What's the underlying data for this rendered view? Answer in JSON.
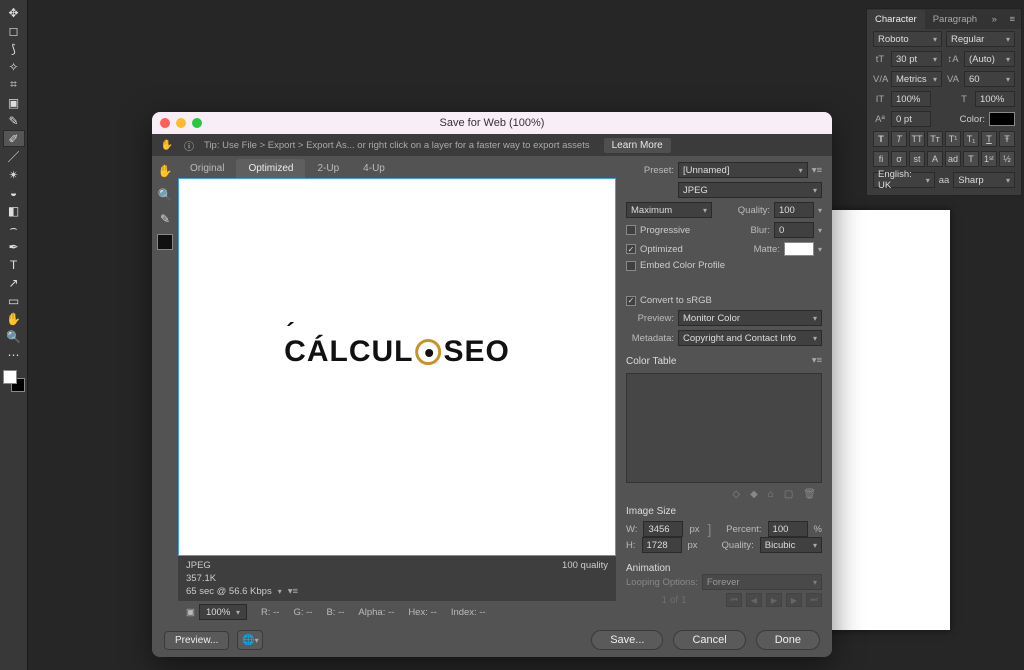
{
  "dialog": {
    "title": "Save for Web (100%)",
    "tip": "Tip: Use File > Export > Export As... or right click on a layer for a faster way to export assets",
    "learn_more": "Learn More",
    "tabs": {
      "original": "Original",
      "optimized": "Optimized",
      "two_up": "2-Up",
      "four_up": "4-Up"
    },
    "preview": {
      "brand_left": "CÁLCUL",
      "brand_right": "SEO",
      "format": "JPEG",
      "size": "357.1K",
      "transfer": "65 sec @ 56.6 Kbps",
      "quality_readout": "100 quality"
    },
    "info": {
      "zoom": "100%",
      "r": "R:  --",
      "g": "G:  --",
      "b": "B:  --",
      "alpha": "Alpha:  --",
      "hex": "Hex:  --",
      "index": "Index:  --"
    },
    "buttons": {
      "preview": "Preview...",
      "save": "Save...",
      "cancel": "Cancel",
      "done": "Done"
    }
  },
  "export": {
    "preset_label": "Preset:",
    "preset_value": "[Unnamed]",
    "format": "JPEG",
    "quality_preset": "Maximum",
    "quality_label": "Quality:",
    "quality_value": "100",
    "progressive": "Progressive",
    "blur_label": "Blur:",
    "blur_value": "0",
    "optimized": "Optimized",
    "matte_label": "Matte:",
    "embed_profile": "Embed Color Profile",
    "convert_srgb": "Convert to sRGB",
    "preview_label": "Preview:",
    "preview_value": "Monitor Color",
    "metadata_label": "Metadata:",
    "metadata_value": "Copyright and Contact Info",
    "color_table": "Color Table",
    "image_size_hdr": "Image Size",
    "w_label": "W:",
    "w_value": "3456",
    "h_label": "H:",
    "h_value": "1728",
    "px": "px",
    "percent_label": "Percent:",
    "percent_value": "100",
    "percent_unit": "%",
    "quality_algo_label": "Quality:",
    "quality_algo": "Bicubic",
    "animation_hdr": "Animation",
    "looping_label": "Looping Options:",
    "looping_value": "Forever",
    "frame_of": "1 of 1"
  },
  "charpanel": {
    "tab_character": "Character",
    "tab_paragraph": "Paragraph",
    "font": "Roboto",
    "style": "Regular",
    "size_value": "30 pt",
    "leading_value": "(Auto)",
    "kerning_value": "Metrics",
    "tracking_value": "60",
    "vscale": "100%",
    "hscale": "100%",
    "baseline": "0 pt",
    "color_label": "Color:",
    "lang": "English: UK",
    "aa_label": "aa",
    "aa_value": "Sharp"
  }
}
